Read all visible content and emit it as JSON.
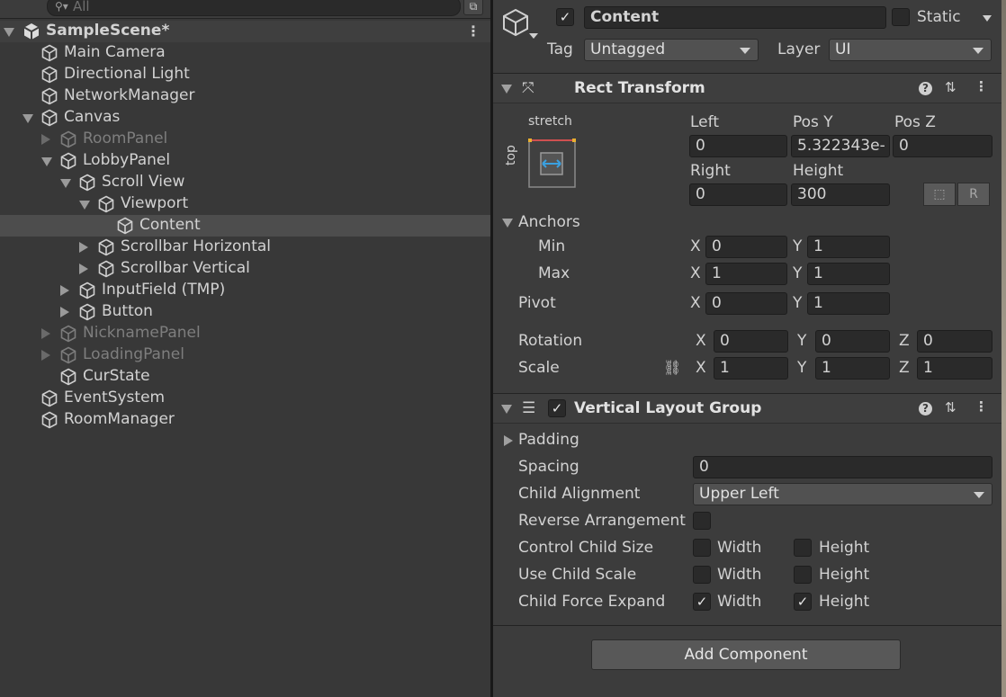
{
  "hierarchy": {
    "search_placeholder": "All",
    "search_icon": "search-icon",
    "scene_name": "SampleScene*",
    "items": [
      {
        "label": "Main Camera"
      },
      {
        "label": "Directional Light"
      },
      {
        "label": "NetworkManager"
      },
      {
        "label": "Canvas"
      },
      {
        "label": "RoomPanel"
      },
      {
        "label": "LobbyPanel"
      },
      {
        "label": "Scroll View"
      },
      {
        "label": "Viewport"
      },
      {
        "label": "Content"
      },
      {
        "label": "Scrollbar Horizontal"
      },
      {
        "label": "Scrollbar Vertical"
      },
      {
        "label": "InputField (TMP)"
      },
      {
        "label": "Button"
      },
      {
        "label": "NicknamePanel"
      },
      {
        "label": "LoadingPanel"
      },
      {
        "label": "CurState"
      },
      {
        "label": "EventSystem"
      },
      {
        "label": "RoomManager"
      }
    ]
  },
  "inspector": {
    "object_name": "Content",
    "active": true,
    "static_label": "Static",
    "tag_label": "Tag",
    "tag_value": "Untagged",
    "layer_label": "Layer",
    "layer_value": "UI",
    "rect_transform": {
      "title": "Rect Transform",
      "anchor_preset_h": "stretch",
      "anchor_preset_v": "top",
      "left_label": "Left",
      "left_value": "0",
      "posy_label": "Pos Y",
      "posy_value": "5.322343e-",
      "posz_label": "Pos Z",
      "posz_value": "0",
      "right_label": "Right",
      "right_value": "0",
      "height_label": "Height",
      "height_value": "300",
      "anchors_label": "Anchors",
      "min_label": "Min",
      "min_x": "0",
      "min_y": "1",
      "max_label": "Max",
      "max_x": "1",
      "max_y": "1",
      "pivot_label": "Pivot",
      "pivot_x": "0",
      "pivot_y": "1",
      "rotation_label": "Rotation",
      "rot_x": "0",
      "rot_y": "0",
      "rot_z": "0",
      "scale_label": "Scale",
      "scale_x": "1",
      "scale_y": "1",
      "scale_z": "1",
      "x": "X",
      "y": "Y",
      "z": "Z",
      "r_button": "R"
    },
    "vertical_layout_group": {
      "title": "Vertical Layout Group",
      "padding_label": "Padding",
      "spacing_label": "Spacing",
      "spacing_value": "0",
      "child_alignment_label": "Child Alignment",
      "child_alignment_value": "Upper Left",
      "reverse_label": "Reverse Arrangement",
      "control_size_label": "Control Child Size",
      "use_scale_label": "Use Child Scale",
      "force_expand_label": "Child Force Expand",
      "width": "Width",
      "height": "Height",
      "control_width": false,
      "control_height": false,
      "scale_width": false,
      "scale_height": false,
      "expand_width": true,
      "expand_height": true
    },
    "add_component": "Add Component"
  }
}
